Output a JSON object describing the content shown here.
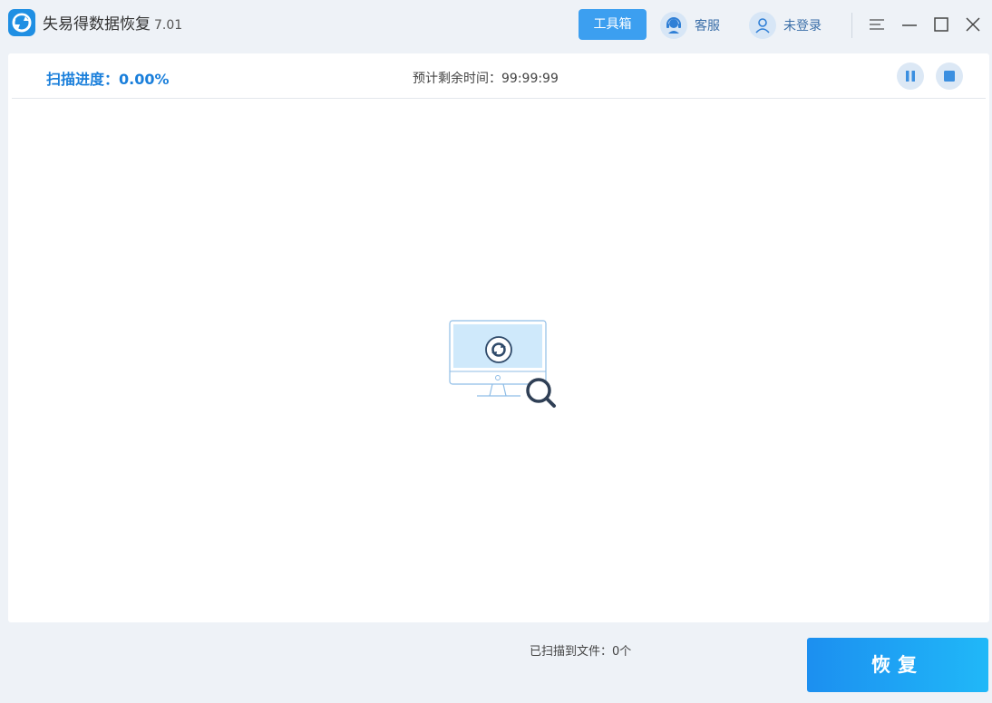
{
  "app": {
    "title": "失易得数据恢复",
    "version": "7.01",
    "brand_color": "#1f8fe3"
  },
  "titlebar": {
    "toolbox_label": "工具箱",
    "service_label": "客服",
    "login_label": "未登录"
  },
  "scan": {
    "progress_text": "扫描进度：0.00%",
    "remaining_text": "预计剩余时间：99:99:99",
    "progress_value": 0.0
  },
  "footer": {
    "files_found_text": "已扫描到文件：0个",
    "recover_label": "恢复"
  },
  "icons": {
    "logo": "app-logo-icon",
    "service": "customer-service-icon",
    "login": "user-icon",
    "pause": "pause-icon",
    "stop": "stop-icon",
    "illustration": "monitor-search-icon"
  }
}
